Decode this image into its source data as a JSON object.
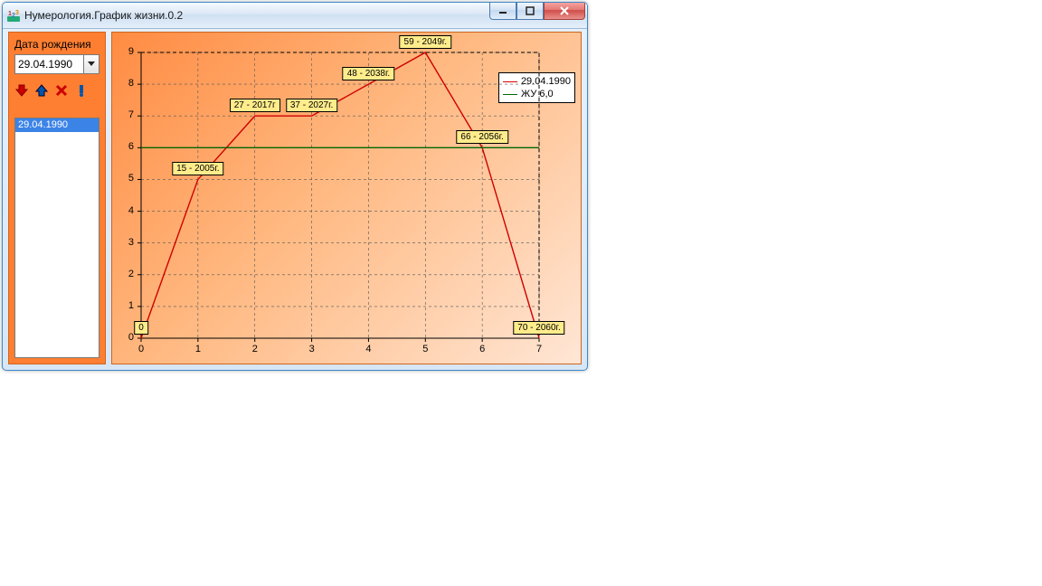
{
  "window": {
    "title": "Нумерология.График жизни.0.2"
  },
  "sidebar": {
    "label": "Дата рождения",
    "date_value": "29.04.1990",
    "items": [
      "29.04.1990"
    ]
  },
  "legend": {
    "a": "29.04.1990",
    "b": "ЖУ 6,0"
  },
  "chart_data": {
    "type": "line",
    "xlabel": "",
    "ylabel": "",
    "xlim": [
      0,
      7
    ],
    "ylim": [
      0,
      9
    ],
    "x_ticks": [
      0,
      1,
      2,
      3,
      4,
      5,
      6,
      7
    ],
    "y_ticks": [
      0,
      1,
      2,
      3,
      4,
      5,
      6,
      7,
      8,
      9
    ],
    "series": [
      {
        "name": "29.04.1990",
        "color": "#d00000",
        "x": [
          0,
          1,
          2,
          3,
          4,
          5,
          6,
          7
        ],
        "y": [
          0,
          5,
          7,
          7,
          8,
          9,
          6,
          0
        ]
      },
      {
        "name": "ЖУ 6,0",
        "color": "#006600",
        "x": [
          0,
          7
        ],
        "y": [
          6,
          6
        ]
      }
    ],
    "point_labels": [
      {
        "x": 0,
        "y": 0,
        "text": "0"
      },
      {
        "x": 1,
        "y": 5,
        "text": "15 - 2005г."
      },
      {
        "x": 2,
        "y": 7,
        "text": "27 - 2017г"
      },
      {
        "x": 3,
        "y": 7,
        "text": "37 - 2027г."
      },
      {
        "x": 4,
        "y": 8,
        "text": "48 - 2038г."
      },
      {
        "x": 5,
        "y": 9,
        "text": "59 - 2049г."
      },
      {
        "x": 6,
        "y": 6,
        "text": "66 - 2056г."
      },
      {
        "x": 7,
        "y": 0,
        "text": "70 - 2060г."
      }
    ]
  }
}
